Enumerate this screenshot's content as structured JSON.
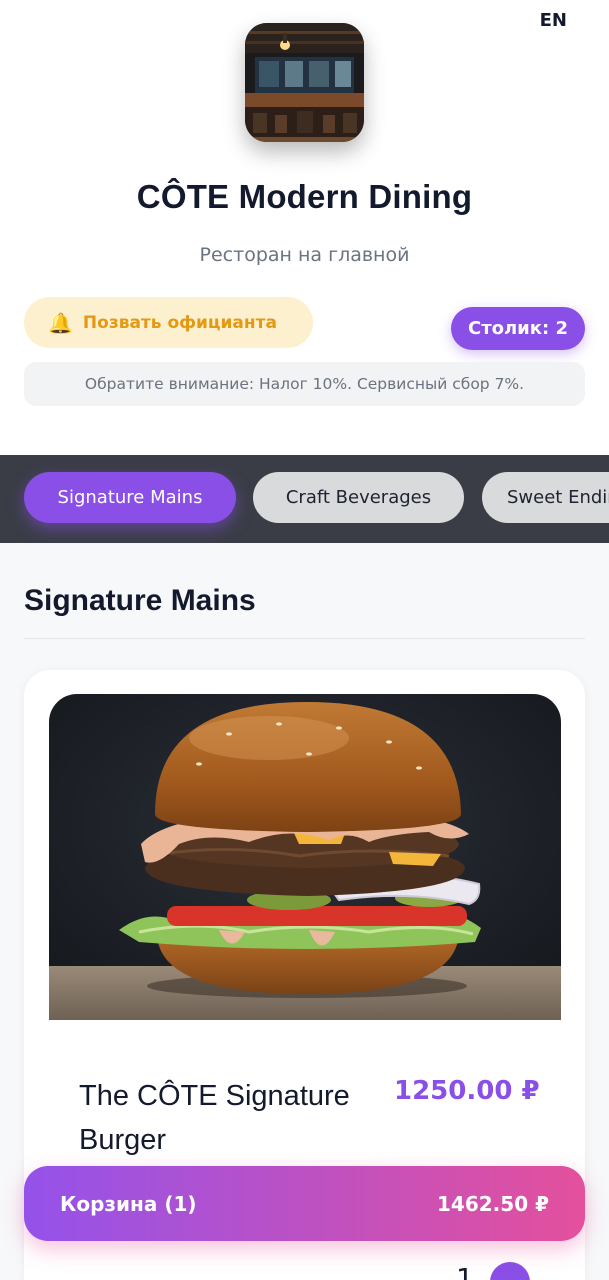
{
  "header": {
    "lang": "EN",
    "restaurant_name": "CÔTE Modern Dining",
    "subtitle": "Ресторан на главной",
    "call_waiter_label": "Позвать официанта",
    "call_waiter_icon": "🔔",
    "table_label": "Столик: 2",
    "notice": "Обратите внимание: Налог 10%. Сервисный сбор 7%."
  },
  "categories": [
    {
      "label": "Signature Mains",
      "active": true
    },
    {
      "label": "Craft Beverages",
      "active": false
    },
    {
      "label": "Sweet Endings",
      "active": false
    }
  ],
  "section": {
    "title": "Signature Mains"
  },
  "items": [
    {
      "name": "The CÔTE Signature Burger",
      "price": "1250.00 ₽",
      "quantity": "1"
    }
  ],
  "cart": {
    "label": "Корзина (1)",
    "total": "1462.50 ₽"
  },
  "colors": {
    "accent": "#8a4fe6",
    "cart_gradient_start": "#9452ea",
    "cart_gradient_end": "#e4509c",
    "waiter_bg": "#fdf0cf",
    "waiter_text": "#e39a12",
    "category_bar": "#3a3d46"
  }
}
